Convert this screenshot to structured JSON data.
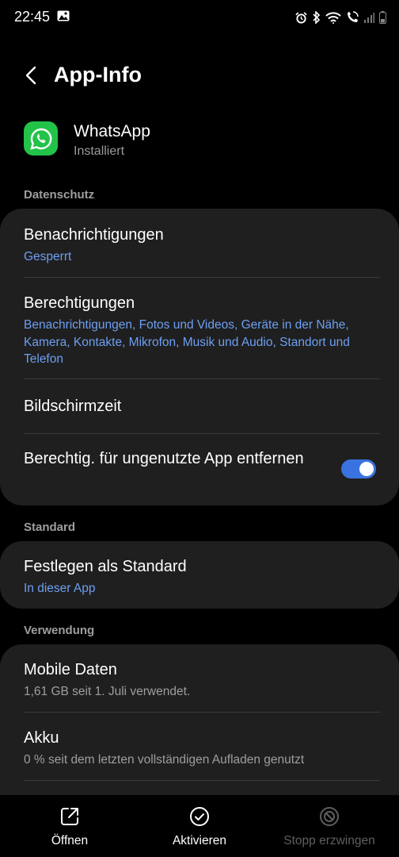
{
  "status_bar": {
    "time": "22:45"
  },
  "header": {
    "title": "App-Info"
  },
  "app": {
    "name": "WhatsApp",
    "status": "Installiert",
    "icon": "whatsapp-logo-icon",
    "color": "#23c249"
  },
  "sections": {
    "privacy": {
      "label": "Datenschutz",
      "notifications_title": "Benachrichtigungen",
      "notifications_value": "Gesperrt",
      "permissions_title": "Berechtigungen",
      "permissions_value": "Benachrichtigungen, Fotos und Videos, Geräte in der Nähe, Kamera, Kontakte, Mikrofon, Musik und Audio, Standort und Telefon",
      "screen_time_title": "Bildschirmzeit",
      "remove_permissions_title": "Berechtig. für ungenutzte App entfernen",
      "remove_permissions_enabled": true
    },
    "default": {
      "label": "Standard",
      "set_default_title": "Festlegen als Standard",
      "set_default_value": "In dieser App"
    },
    "usage": {
      "label": "Verwendung",
      "mobile_data_title": "Mobile Daten",
      "mobile_data_value": "1,61 GB seit 1. Juli verwendet.",
      "battery_title": "Akku",
      "battery_value": "0 % seit dem letzten vollständigen Aufladen genutzt"
    }
  },
  "bottom_bar": {
    "open_label": "Öffnen",
    "activate_label": "Aktivieren",
    "force_stop_label": "Stopp erzwingen"
  },
  "colors": {
    "accent": "#6d9ff3",
    "toggle": "#3a73e0",
    "card": "#1f1f1f",
    "background": "#000000"
  }
}
